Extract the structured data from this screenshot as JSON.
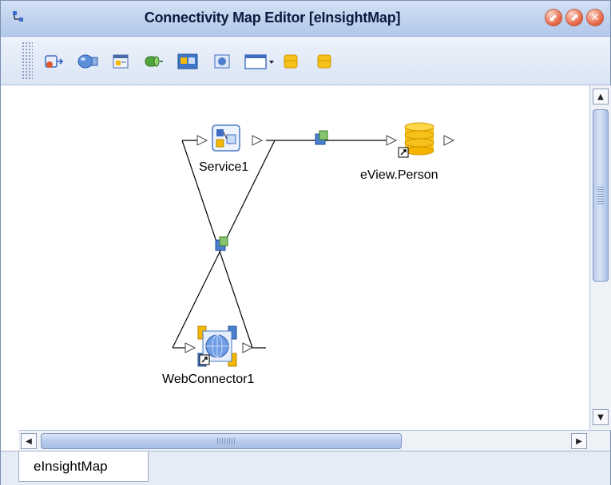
{
  "window": {
    "title": "Connectivity Map Editor [eInsightMap]",
    "controls": [
      "minimize-icon",
      "maximize-icon",
      "close-icon"
    ]
  },
  "toolbar": {
    "buttons": [
      {
        "icon": "new-collaboration-icon"
      },
      {
        "icon": "external-application-icon"
      },
      {
        "icon": "business-process-icon"
      },
      {
        "icon": "topic-icon"
      },
      {
        "icon": "web-application-icon"
      },
      {
        "icon": "web-connector-icon"
      },
      {
        "icon": "window-dropdown-icon"
      },
      {
        "icon": "database-icon"
      },
      {
        "icon": "database-icon"
      }
    ]
  },
  "map": {
    "nodes": {
      "service": {
        "label": "Service1"
      },
      "eview": {
        "label": "eView.Person"
      },
      "webconnector": {
        "label": "WebConnector1"
      }
    }
  },
  "tabs": [
    {
      "label": "eInsightMap",
      "active": true
    }
  ],
  "colors": {
    "titlebar": "#c1d2ee",
    "accent": "#f5b800",
    "close_button": "#e86a4b"
  }
}
